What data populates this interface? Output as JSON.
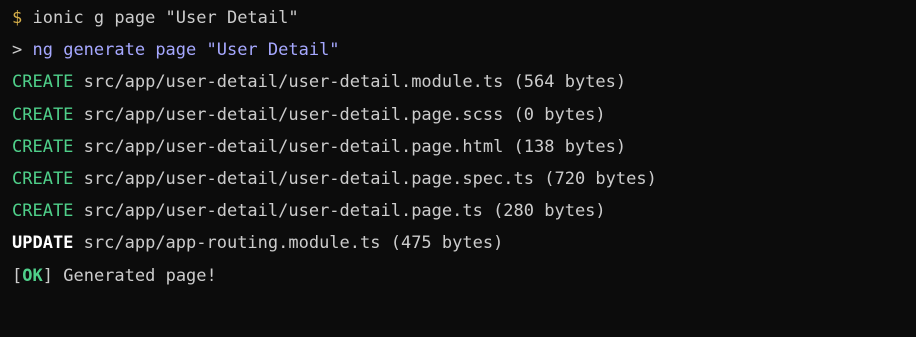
{
  "terminal": {
    "colors": {
      "background": "#0c0c0c",
      "text": "#cccccc",
      "prompt": "#d7b04a",
      "ng_command": "#a6a8ff",
      "create": "#4fd08a",
      "update": "#ffffff",
      "ok": "#4fd08a"
    },
    "command_line": {
      "prompt": "$",
      "text": "ionic g page \"User Detail\""
    },
    "ng_line": {
      "marker": ">",
      "text": "ng generate page \"User Detail\""
    },
    "create_lines": [
      {
        "action": "CREATE",
        "text": "src/app/user-detail/user-detail.module.ts (564 bytes)"
      },
      {
        "action": "CREATE",
        "text": "src/app/user-detail/user-detail.page.scss (0 bytes)"
      },
      {
        "action": "CREATE",
        "text": "src/app/user-detail/user-detail.page.html (138 bytes)"
      },
      {
        "action": "CREATE",
        "text": "src/app/user-detail/user-detail.page.spec.ts (720 bytes)"
      },
      {
        "action": "CREATE",
        "text": "src/app/user-detail/user-detail.page.ts (280 bytes)"
      }
    ],
    "update_line": {
      "action": "UPDATE",
      "text": "src/app/app-routing.module.ts (475 bytes)"
    },
    "status_line": {
      "open": "[",
      "ok": "OK",
      "close": "]",
      "text": "Generated page!"
    }
  }
}
